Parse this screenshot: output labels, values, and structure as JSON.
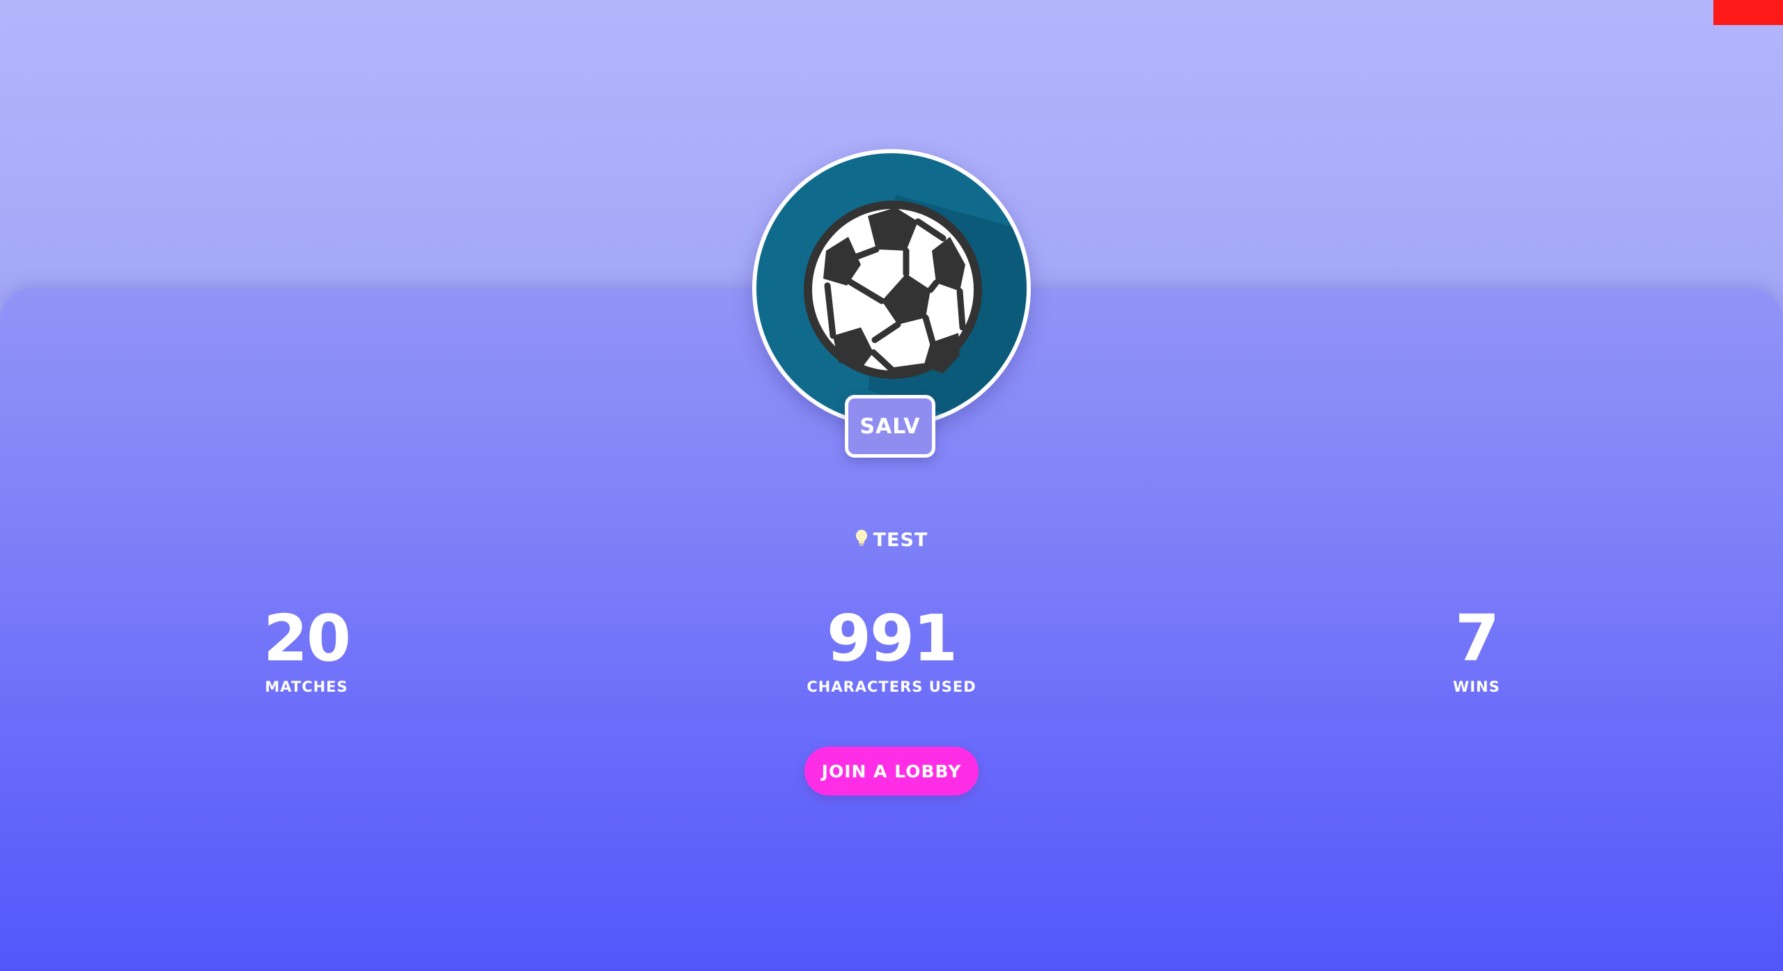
{
  "profile": {
    "username": "SALV",
    "avatar_icon": "soccer-ball-icon",
    "tagline": "TEST",
    "tagline_icon": "lightbulb-icon"
  },
  "stats": {
    "matches": {
      "value": "20",
      "label": "MATCHES"
    },
    "characters_used": {
      "value": "991",
      "label": "CHARACTERS USED"
    },
    "wins": {
      "value": "7",
      "label": "WINS"
    }
  },
  "actions": {
    "join_label": "JOIN A LOBBY"
  },
  "colors": {
    "accent_button": "#ff2ee6",
    "avatar_bg": "#0f6a8b",
    "corner_flag": "#ff1a1a",
    "panel_bottom": "#5357fb"
  }
}
